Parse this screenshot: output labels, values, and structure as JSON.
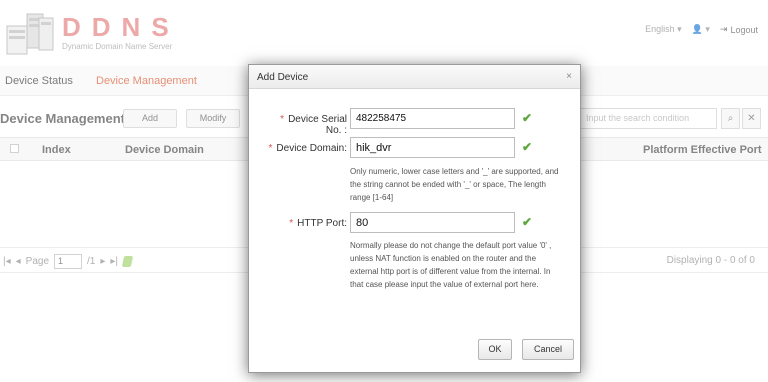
{
  "header": {
    "logo_text": "DDNS",
    "logo_subtitle": "Dynamic Domain Name Server",
    "language": "English",
    "logout_label": "Logout"
  },
  "nav": {
    "device_status": "Device Status",
    "device_management": "Device Management"
  },
  "panel": {
    "title": "Device Management",
    "add_label": "Add",
    "modify_label": "Modify",
    "search_placeholder": "Input the search condition",
    "columns": [
      "Index",
      "Device Domain",
      "Platform Effective Port"
    ]
  },
  "pager": {
    "page_label": "Page",
    "page_value": "1",
    "page_total": "/1",
    "displaying": "Displaying  0 - 0 of 0"
  },
  "dialog": {
    "title": "Add Device",
    "close": "×",
    "serial_label": "Device Serial No. :",
    "serial_value": "482258475",
    "domain_label": "Device Domain:",
    "domain_value": "hik_dvr",
    "domain_hint": "Only numeric, lower case letters and '_' are supported, and the string cannot be ended with '_' or space, The length range [1-64]",
    "port_label": "HTTP Port:",
    "port_value": "80",
    "port_hint": "Normally please do not change the default port value  '0' , unless NAT function is enabled on the router and the external http port is of different value from the internal. In that case please input the value of external port here.",
    "ok_label": "OK",
    "cancel_label": "Cancel"
  },
  "colors": {
    "accent": "#d9532b",
    "logo": "#e47a7a",
    "valid": "#5aa83c",
    "required": "#d9534f"
  }
}
